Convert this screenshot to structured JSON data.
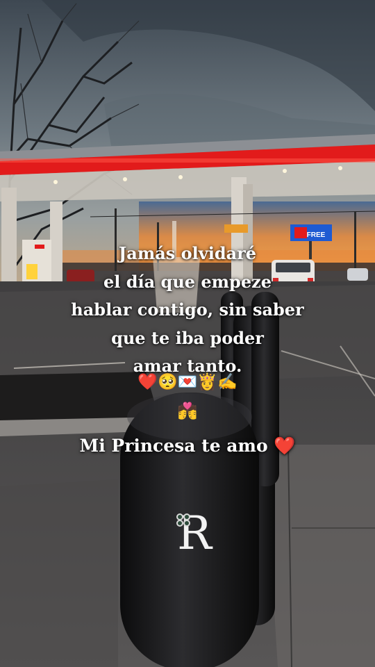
{
  "overlay": {
    "poem_lines": [
      "Jamás olvidaré",
      "el día que empeze",
      "hablar contigo, sin saber",
      "que te iba poder",
      "amar tanto."
    ],
    "emoji_row_1": "❤️🥺💌👸✍️",
    "emoji_row_2": "💏",
    "signoff": "Mi Princesa te amo ❤️"
  },
  "sign": {
    "billboard_text": "FREE"
  },
  "logo": {
    "letter": "R",
    "icon": "clover-icon"
  },
  "colors": {
    "sky_top": "#4a5560",
    "sunset": "#e8873a",
    "canopy_red": "#e21b1b",
    "text": "#ffffff"
  }
}
